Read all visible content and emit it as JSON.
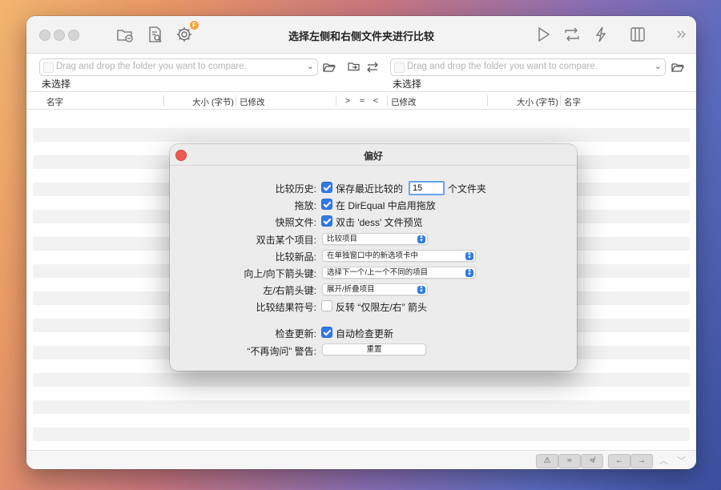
{
  "window": {
    "title": "选择左侧和右侧文件夹进行比较",
    "settings_badge": "F"
  },
  "toolbar_icons": [
    "folder-minus-icon",
    "document-search-icon",
    "gear-icon",
    "play-icon",
    "sync-icon",
    "lightning-icon",
    "sidebar-icon",
    "chevron-double-right-icon"
  ],
  "left_panel": {
    "path_placeholder": "Drag and drop the folder you want to compare.",
    "status": "未选择"
  },
  "right_panel": {
    "path_placeholder": "Drag and drop the folder you want to compare.",
    "status": "未选择"
  },
  "columns": {
    "left_name": "名字",
    "left_size": "大小 (字节)",
    "left_modified": "已修改",
    "cmp_gt": ">",
    "cmp_eq": "=",
    "cmp_lt": "<",
    "right_modified": "已修改",
    "right_size": "大小 (字节)",
    "right_name": "名字"
  },
  "bottom_buttons": [
    "⚠",
    "≈",
    "≉",
    "←",
    "→"
  ],
  "preferences": {
    "title": "偏好",
    "history_label": "比较历史:",
    "history_check_text": "保存最近比较的",
    "history_count": "15",
    "history_suffix": "个文件夹",
    "history_checked": true,
    "dragdrop_label": "拖放:",
    "dragdrop_text": "在 DirEqual 中启用拖放",
    "dragdrop_checked": true,
    "quicklook_label": "快照文件:",
    "quicklook_text": "双击 'dess' 文件预览",
    "quicklook_checked": true,
    "doubleclick_label": "双击某个项目:",
    "doubleclick_value": "比较项目",
    "newcompare_label": "比较新品:",
    "newcompare_value": "在单独窗口中的新选项卡中",
    "updown_label": "向上/向下箭头键:",
    "updown_value": "选择下一个/上一个不同的项目",
    "leftright_label": "左/右箭头键:",
    "leftright_value": "展开/折叠项目",
    "symbol_label": "比较结果符号:",
    "symbol_text": "反转 “仅限左/右” 箭头",
    "symbol_checked": false,
    "update_label": "检查更新:",
    "update_text": "自动检查更新",
    "update_checked": true,
    "warning_label": "“不再询问” 警告:",
    "reset_button": "重置"
  }
}
